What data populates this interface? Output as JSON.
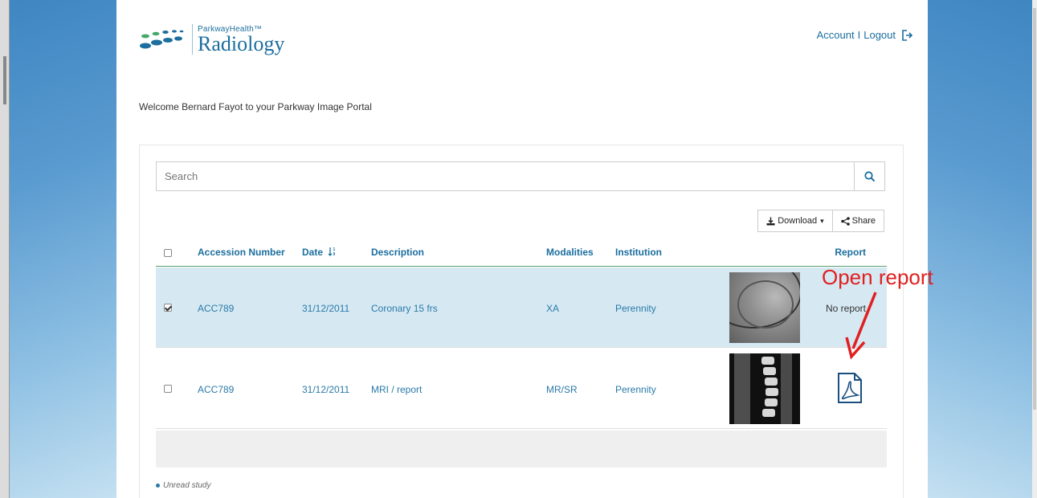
{
  "header": {
    "brand_small": "ParkwayHealth™",
    "brand_big": "Radiology",
    "account_label": "Account",
    "separator": "I",
    "logout_label": "Logout"
  },
  "welcome": "Welcome Bernard Fayot to your Parkway Image Portal",
  "search": {
    "placeholder": "Search"
  },
  "toolbar": {
    "download_label": "Download",
    "share_label": "Share"
  },
  "table": {
    "columns": {
      "accession": "Accession Number",
      "date": "Date",
      "description": "Description",
      "modalities": "Modalities",
      "institution": "Institution",
      "report": "Report"
    },
    "rows": [
      {
        "selected": true,
        "accession": "ACC789",
        "date": "31/12/2011",
        "description": "Coronary 15 frs",
        "modalities": "XA",
        "institution": "Perennity",
        "report": "No report"
      },
      {
        "selected": false,
        "accession": "ACC789",
        "date": "31/12/2011",
        "description": "MRI / report",
        "modalities": "MR/SR",
        "institution": "Perennity",
        "report": ""
      }
    ]
  },
  "legend": {
    "unread_label": "Unread study"
  },
  "annotation": {
    "text": "Open report",
    "color": "#e02020"
  },
  "colors": {
    "accent": "#1b6e9e",
    "selected_row": "#d6e9f3",
    "header_rule": "#5a9d6f"
  }
}
